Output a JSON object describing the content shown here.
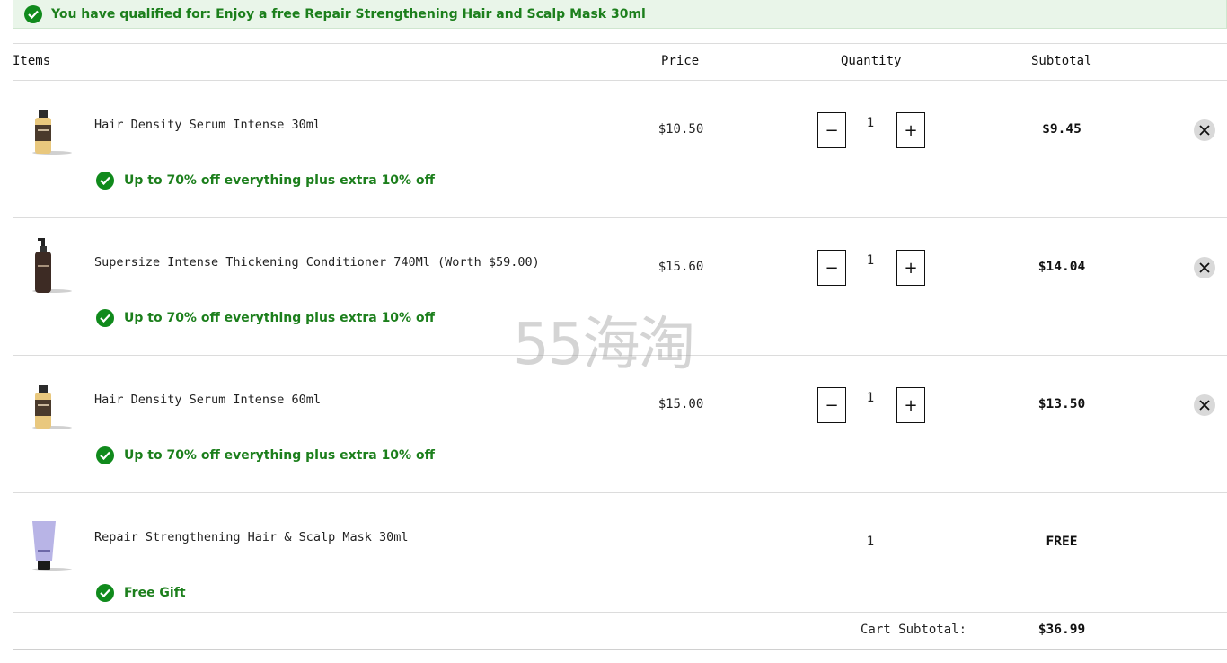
{
  "banner": {
    "text": "You have qualified for: Enjoy a free Repair Strengthening Hair and Scalp Mask 30ml"
  },
  "headers": {
    "items": "Items",
    "price": "Price",
    "quantity": "Quantity",
    "subtotal": "Subtotal"
  },
  "items": [
    {
      "name": "Hair Density Serum Intense 30ml",
      "promo": "Up to 70% off everything plus extra 10% off",
      "price": "$10.50",
      "quantity": "1",
      "subtotal": "$9.45",
      "thumb": "serum-bottle-icon"
    },
    {
      "name": "Supersize Intense Thickening Conditioner 740Ml (Worth $59.00)",
      "promo": "Up to 70% off everything plus extra 10% off",
      "price": "$15.60",
      "quantity": "1",
      "subtotal": "$14.04",
      "thumb": "pump-bottle-icon"
    },
    {
      "name": "Hair Density Serum Intense 60ml",
      "promo": "Up to 70% off everything plus extra 10% off",
      "price": "$15.00",
      "quantity": "1",
      "subtotal": "$13.50",
      "thumb": "serum-bottle-icon"
    },
    {
      "name": "Repair Strengthening Hair & Scalp Mask 30ml",
      "promo": "Free Gift",
      "price": "",
      "quantity": "1",
      "subtotal": "FREE",
      "thumb": "tube-icon"
    }
  ],
  "cart": {
    "subtotal_label": "Cart Subtotal:",
    "subtotal_value": "$36.99"
  },
  "watermark": "55海淘",
  "colors": {
    "accent_green": "#108a1c",
    "promo_text": "#1c7f1c",
    "banner_bg": "#e9f5e9"
  }
}
